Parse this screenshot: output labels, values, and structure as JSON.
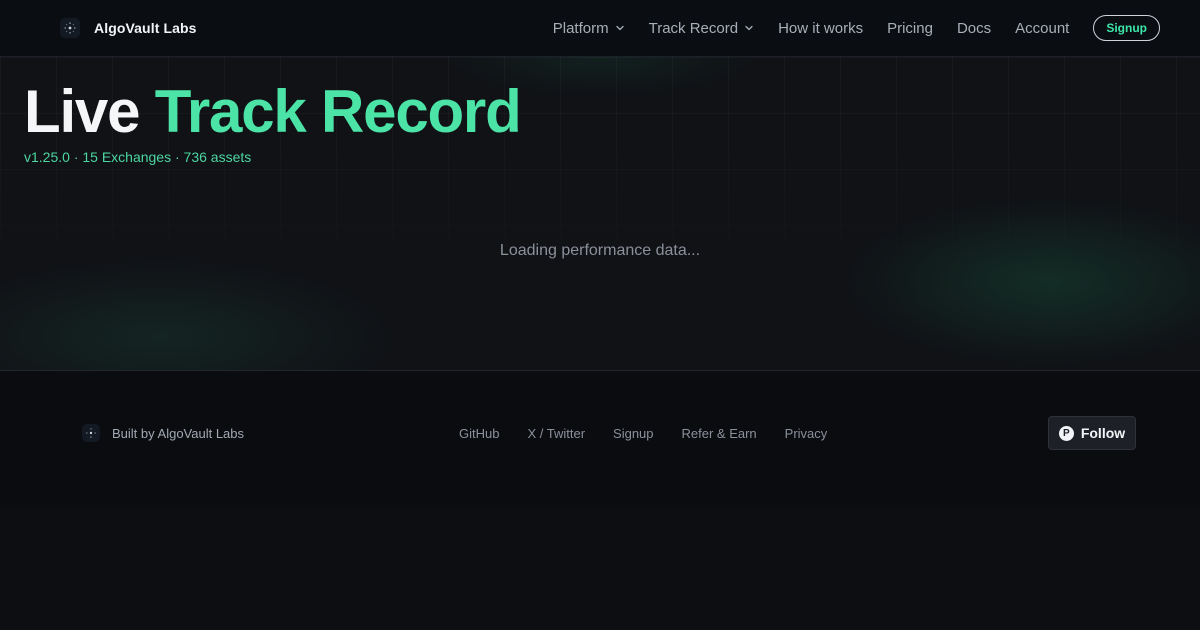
{
  "header": {
    "brand": "AlgoVault Labs",
    "nav": [
      {
        "label": "Platform",
        "dropdown": true
      },
      {
        "label": "Track Record",
        "dropdown": true
      },
      {
        "label": "How it works",
        "dropdown": false
      },
      {
        "label": "Pricing",
        "dropdown": false
      },
      {
        "label": "Docs",
        "dropdown": false
      },
      {
        "label": "Account",
        "dropdown": false
      }
    ],
    "signup_label": "Signup"
  },
  "hero": {
    "title_part1": "Live",
    "title_part2": "Track Record",
    "subtitle": "v1.25.0 · 15 Exchanges · 736 assets",
    "loading_text": "Loading performance data..."
  },
  "footer": {
    "brand_text": "Built by AlgoVault Labs",
    "links": [
      "GitHub",
      "X / Twitter",
      "Signup",
      "Refer & Earn",
      "Privacy"
    ],
    "follow_label": "Follow",
    "follow_icon_letter": "P"
  },
  "colors": {
    "accent": "#4ce3a7",
    "background": "#0d0e12",
    "header_bg": "#0a0d12"
  },
  "icons": {
    "logo": "sparkle-logo-icon",
    "dropdown": "chevron-down-icon",
    "follow": "product-hunt-icon"
  }
}
